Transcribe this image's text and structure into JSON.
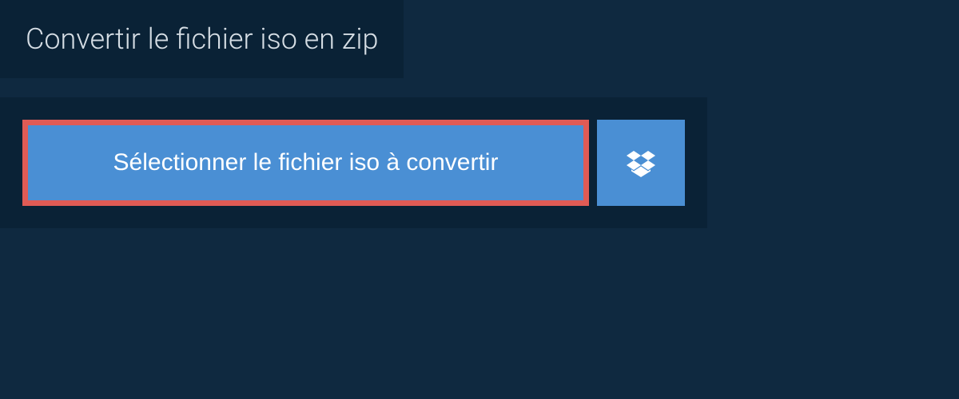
{
  "header": {
    "title": "Convertir le fichier iso en zip"
  },
  "buttons": {
    "select_label": "Sélectionner le fichier iso à convertir"
  }
}
